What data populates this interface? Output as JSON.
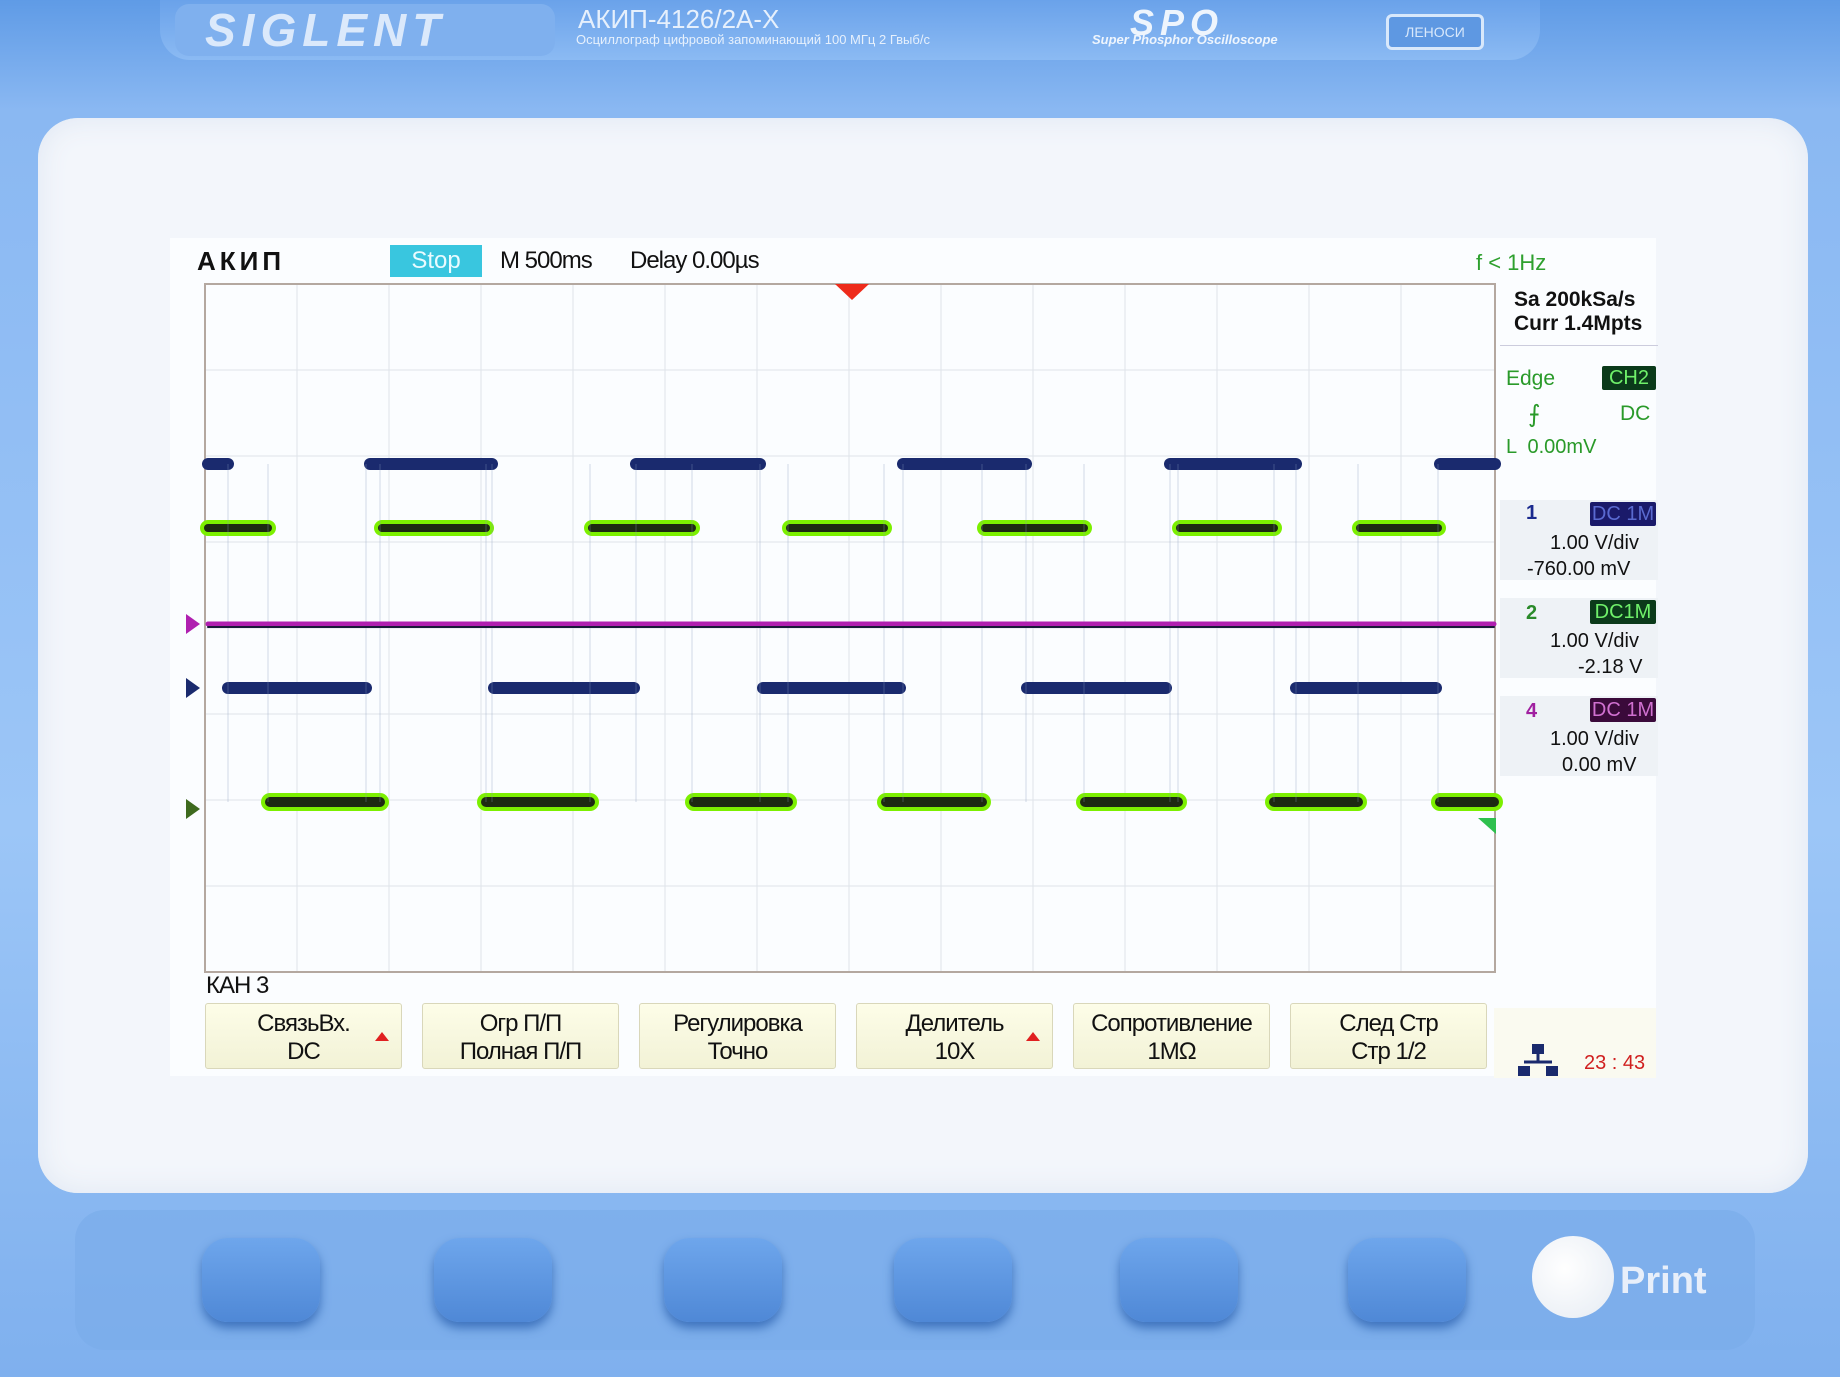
{
  "device": {
    "brand": "SIGLENT",
    "model": "АКИП-4126/2А-Х",
    "subtitle": "Осциллограф цифровой запоминающий  100 МГц  2 Гвыб/с",
    "series_logo": "SPO",
    "series_sub": "Super Phosphor Oscilloscope",
    "badge": "ЛЕНОСИ"
  },
  "screen": {
    "logo": "АКИП",
    "run_state": "Stop",
    "timebase": "M 500ms",
    "delay": "Delay 0.00µs",
    "freq": "f < 1Hz",
    "sample_rate": "Sa 200kSa/s",
    "memory": "Curr 1.4Mpts",
    "trigger": {
      "type": "Edge",
      "source": "CH2",
      "slope_icon": "rising-edge-icon",
      "coupling": "DC",
      "level": "L  0.00mV"
    },
    "channels": [
      {
        "num": "1",
        "coupling": "DC 1M",
        "scale": "1.00 V/div",
        "offset": "-760.00 mV",
        "chip_bg": "#1a1a6a",
        "chip_fg": "#5a6ad0",
        "color": "#1a2a6e"
      },
      {
        "num": "2",
        "coupling": "DC1M",
        "scale": "1.00 V/div",
        "offset": "-2.18 V",
        "chip_bg": "#0b3a1a",
        "chip_fg": "#6ff06a",
        "color": "#7cf000"
      },
      {
        "num": "4",
        "coupling": "DC 1M",
        "scale": "1.00 V/div",
        "offset": "0.00 mV",
        "chip_bg": "#3a0a3a",
        "chip_fg": "#d070d0",
        "color": "#b020b0"
      }
    ],
    "menu_title": "КАН 3",
    "softkeys": [
      {
        "line1": "СвязьВх.",
        "line2": "DC",
        "arrow": true
      },
      {
        "line1": "Огр  П/П",
        "line2": "Полная П/П",
        "arrow": false
      },
      {
        "line1": "Регулировка",
        "line2": "Точно",
        "arrow": false
      },
      {
        "line1": "Делитель",
        "line2": "10X",
        "arrow": true
      },
      {
        "line1": "Сопротивление",
        "line2": "1MΩ",
        "arrow": false
      },
      {
        "line1": "След  Стр",
        "line2": "Стр 1/2",
        "arrow": false
      }
    ],
    "clock": "23 : 43",
    "network_icon": "network-icon"
  },
  "panel": {
    "print_label": "Print"
  }
}
